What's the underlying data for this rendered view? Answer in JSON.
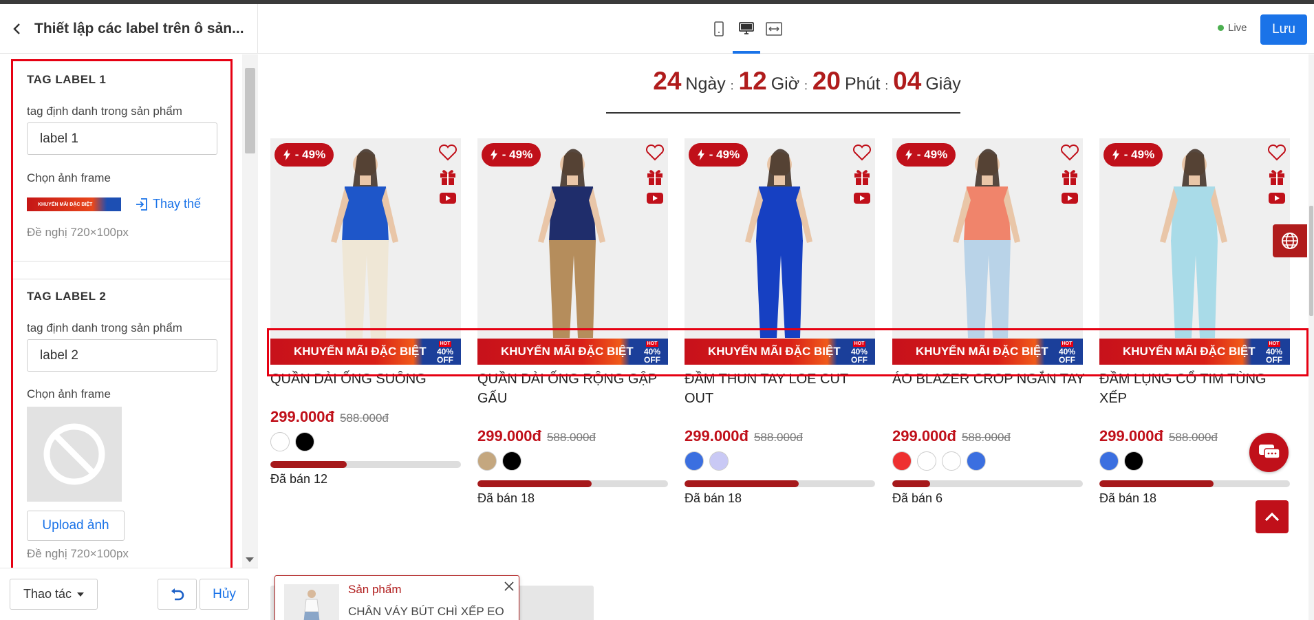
{
  "header": {
    "title": "Thiết lập các label trên ô sản...",
    "live_label": "Live",
    "save_label": "Lưu",
    "devices": [
      "mobile",
      "desktop",
      "full-width"
    ]
  },
  "sidebar": {
    "label1": {
      "section_title": "TAG LABEL 1",
      "tag_label": "tag định danh trong sản phẩm",
      "tag_value": "label 1",
      "frame_label": "Chọn ảnh frame",
      "frame_thumb_text": "KHUYẾN MÃI ĐẶC BIỆT",
      "replace_label": "Thay thế",
      "hint": "Đề nghị 720×100px"
    },
    "label2": {
      "section_title": "TAG LABEL 2",
      "tag_label": "tag định danh trong sản phẩm",
      "tag_value": "label 2",
      "frame_label": "Chọn ảnh frame",
      "upload_label": "Upload ảnh",
      "hint": "Đề nghị 720×100px"
    },
    "footer": {
      "actions_label": "Thao tác",
      "cancel_label": "Hủy"
    }
  },
  "preview": {
    "countdown": {
      "days": "24",
      "days_unit": "Ngày",
      "hours": "12",
      "hours_unit": "Giờ",
      "minutes": "20",
      "minutes_unit": "Phút",
      "seconds": "04",
      "seconds_unit": "Giây",
      "sep": ":"
    },
    "promo_text": "KHUYẾN MÃI ĐẶC BIỆT",
    "promo_tag_hot": "HOT",
    "promo_tag_pct": "40%",
    "promo_tag_off": "OFF",
    "products": [
      {
        "discount": "- 49%",
        "name": "QUẦN DÀI ỐNG SUÔNG",
        "price": "299.000đ",
        "old_price": "588.000đ",
        "swatches": [
          "#ffffff",
          "#000000"
        ],
        "sold_fraction": 0.4,
        "sold": "Đã bán 12"
      },
      {
        "discount": "- 49%",
        "name": "QUẦN DÀI ỐNG RỘNG GẬP GẤU",
        "price": "299.000đ",
        "old_price": "588.000đ",
        "swatches": [
          "#c4a77f",
          "#000000"
        ],
        "sold_fraction": 0.6,
        "sold": "Đã bán 18"
      },
      {
        "discount": "- 49%",
        "name": "ĐẦM THUN TAY LOE CUT OUT",
        "price": "299.000đ",
        "old_price": "588.000đ",
        "swatches": [
          "#3b6fe0",
          "#c9c9f5"
        ],
        "sold_fraction": 0.6,
        "sold": "Đã bán 18"
      },
      {
        "discount": "- 49%",
        "name": "ÁO BLAZER CROP NGẮN TAY",
        "price": "299.000đ",
        "old_price": "588.000đ",
        "swatches": [
          "#ee3030",
          "#ffffff",
          "#ffffff",
          "#3b6fe0"
        ],
        "sold_fraction": 0.2,
        "sold": "Đã bán 6"
      },
      {
        "discount": "- 49%",
        "name": "ĐẦM LỤNG CỔ TIM TÙNG XẾP",
        "price": "299.000đ",
        "old_price": "588.000đ",
        "swatches": [
          "#3b6fe0",
          "#000000"
        ],
        "sold_fraction": 0.6,
        "sold": "Đã bán 18"
      }
    ],
    "popup": {
      "title": "Sản phẩm",
      "name": "CHÂN VÁY BÚT CHÌ XẾP EO"
    },
    "chat_label": "Liên hệ"
  },
  "colors": {
    "accent": "#1a73e8",
    "brand_red": "#c0101a",
    "live": "#4caf50"
  }
}
